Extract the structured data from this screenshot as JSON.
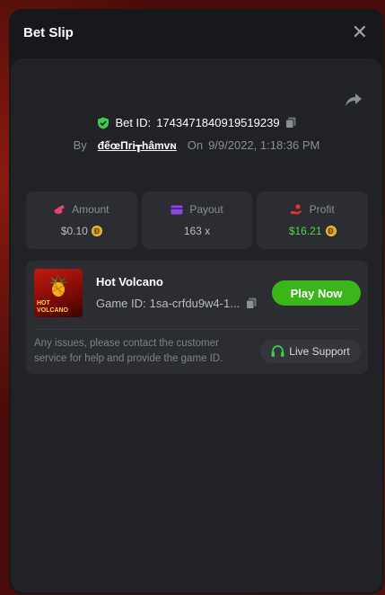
{
  "modal": {
    "title": "Bet Slip",
    "close_icon": "close-icon"
  },
  "bet": {
    "bet_id_label": "Bet ID:",
    "bet_id": "1743471840919519239",
    "by_label": "By",
    "username": "đếœΠri┰hâmᴠɴ",
    "on_label": "On",
    "timestamp": "9/9/2022, 1:18:36 PM"
  },
  "stats": {
    "amount": {
      "label": "Amount",
      "value": "$0.10",
      "icon": "amount-coins-icon",
      "color": "#e2446b"
    },
    "payout": {
      "label": "Payout",
      "value": "163 x",
      "icon": "payout-card-icon",
      "color": "#8a48e0"
    },
    "profit": {
      "label": "Profit",
      "value": "$16.21",
      "icon": "profit-hand-icon",
      "color": "#e3342f",
      "value_color": "#54d34a"
    }
  },
  "game": {
    "name": "Hot Volcano",
    "id_label": "Game ID:",
    "id_value": "1sa-crfdu9w4-1...",
    "thumb_text_1": "HOT",
    "thumb_text_2": "VOLCANO",
    "play_label": "Play Now",
    "issues_text": "Any issues, please contact the customer service for help and provide the game ID.",
    "support_label": "Live Support"
  },
  "colors": {
    "accent_green": "#3ab51a",
    "shield_green": "#3ccb4a",
    "coin_gold": "#d9a21b"
  }
}
